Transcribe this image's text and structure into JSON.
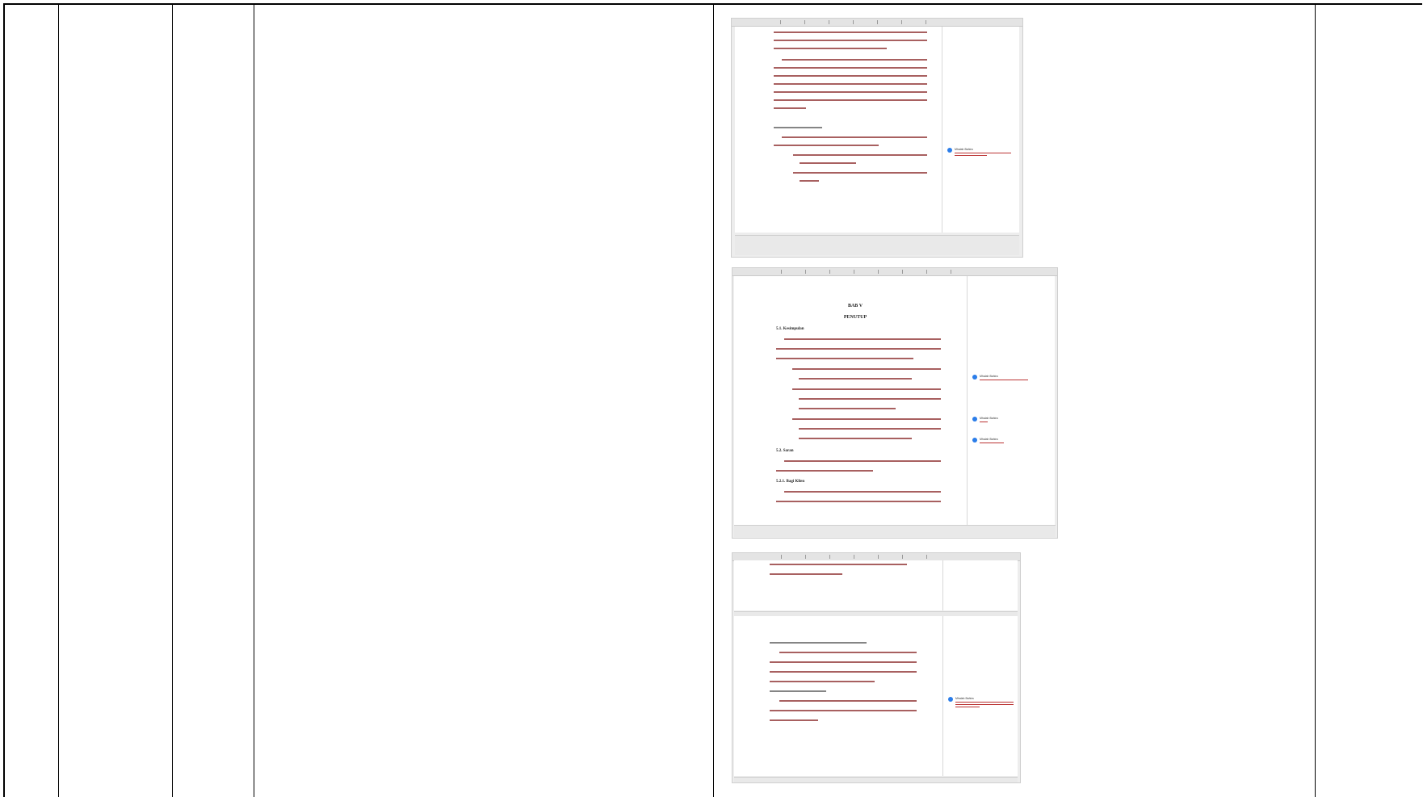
{
  "screenshot_1": {
    "comment": {
      "author": "Mhalah Bahira"
    }
  },
  "screenshot_2": {
    "chapter": "BAB V",
    "chapter_title": "PENUTUP",
    "section_1": "5.1. Kesimpulan",
    "section_2": "5.2. Saran",
    "section_2_1": "5.2.1. Bagi Klien",
    "comments": [
      {
        "author": "Mhalah Bahira"
      },
      {
        "author": "Mhalah Bahira"
      },
      {
        "author": "Mhalah Bahira"
      }
    ]
  },
  "screenshot_3": {
    "comment": {
      "author": "Mhalah Bahira"
    }
  }
}
